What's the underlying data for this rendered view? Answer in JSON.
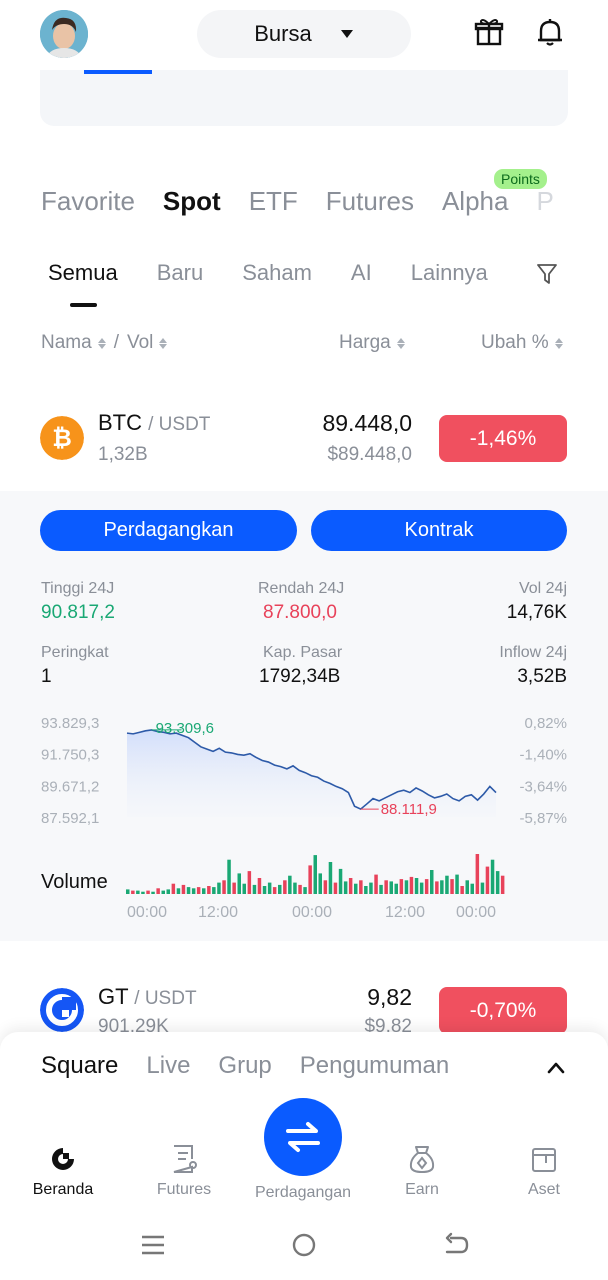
{
  "header": {
    "exchange_label": "Bursa"
  },
  "category_tabs": [
    {
      "label": "Favorite",
      "active": false
    },
    {
      "label": "Spot",
      "active": true
    },
    {
      "label": "ETF",
      "active": false
    },
    {
      "label": "Futures",
      "active": false
    },
    {
      "label": "Alpha",
      "active": false
    },
    {
      "label": "P",
      "active": false
    }
  ],
  "points_badge": "Points",
  "sub_tabs": [
    {
      "label": "Semua",
      "active": true
    },
    {
      "label": "Baru",
      "active": false
    },
    {
      "label": "Saham",
      "active": false
    },
    {
      "label": "AI",
      "active": false
    },
    {
      "label": "Lainnya",
      "active": false
    }
  ],
  "columns": {
    "name": "Nama",
    "separator": "/",
    "vol": "Vol",
    "price": "Harga",
    "change": "Ubah %"
  },
  "btc": {
    "symbol": "BTC",
    "quote": "/ USDT",
    "volume": "1,32B",
    "price": "89.448,0",
    "price_usd": "$89.448,0",
    "change": "-1,46%"
  },
  "detail": {
    "trade_button": "Perdagangkan",
    "contract_button": "Kontrak",
    "high_label": "Tinggi 24J",
    "high_value": "90.817,2",
    "low_label": "Rendah 24J",
    "low_value": "87.800,0",
    "vol_label": "Vol 24j",
    "vol_value": "14,76K",
    "rank_label": "Peringkat",
    "rank_value": "1",
    "mcap_label": "Kap. Pasar",
    "mcap_value": "1792,34B",
    "inflow_label": "Inflow 24j",
    "inflow_value": "3,52B",
    "volume_label": "Volume"
  },
  "chart_data": {
    "type": "line",
    "y_left_ticks": [
      "93.829,3",
      "91.750,3",
      "89.671,2",
      "87.592,1"
    ],
    "y_right_ticks": [
      "0,82%",
      "-1,40%",
      "-3,64%",
      "-5,87%"
    ],
    "x_ticks": [
      "00:00",
      "12:00",
      "00:00",
      "12:00",
      "00:00"
    ],
    "annotations": {
      "high": "93.309,6",
      "low": "88.111,9"
    },
    "ylim": [
      87592.1,
      93829.3
    ],
    "series": [
      {
        "values": [
          93100,
          93050,
          93150,
          93250,
          93309.6,
          93200,
          93150,
          93050,
          93100,
          92950,
          92800,
          92500,
          92200,
          92050,
          91900,
          92100,
          91850,
          91800,
          91700,
          91650,
          91750,
          91500,
          91300,
          91200,
          91000,
          90900,
          90750,
          90950,
          90650,
          90500,
          90300,
          90200,
          89950,
          89800,
          89600,
          89450,
          89200,
          88300,
          88111.9,
          88450,
          88800,
          88650,
          88850,
          89050,
          89250,
          89350,
          89200,
          89500,
          89300,
          89050,
          88850,
          88950,
          89100,
          88800,
          88650,
          88950,
          89050,
          88700,
          89100,
          89600,
          89200
        ]
      }
    ],
    "volume": [
      4,
      3,
      3,
      2,
      3,
      2,
      5,
      3,
      4,
      9,
      5,
      8,
      6,
      5,
      6,
      5,
      7,
      6,
      10,
      12,
      30,
      10,
      18,
      9,
      20,
      8,
      14,
      7,
      10,
      6,
      8,
      12,
      16,
      10,
      8,
      6,
      25,
      34,
      18,
      12,
      28,
      10,
      22,
      11,
      14,
      9,
      12,
      7,
      10,
      17,
      8,
      12,
      11,
      9,
      13,
      12,
      15,
      14,
      10,
      13,
      21,
      11,
      12,
      16,
      13,
      17,
      7,
      12,
      9,
      35,
      10,
      24,
      30,
      20,
      16
    ]
  },
  "gt": {
    "symbol": "GT",
    "quote": "/ USDT",
    "volume": "901,29K",
    "price": "9,82",
    "price_usd": "$9,82",
    "change": "-0,70%"
  },
  "feed_tabs": [
    {
      "label": "Square",
      "active": true
    },
    {
      "label": "Live",
      "active": false
    },
    {
      "label": "Grup",
      "active": false
    },
    {
      "label": "Pengumuman",
      "active": false
    }
  ],
  "bottom_nav": [
    {
      "label": "Beranda",
      "active": true
    },
    {
      "label": "Futures",
      "active": false
    },
    {
      "label": "Perdagangan",
      "active": false
    },
    {
      "label": "Earn",
      "active": false
    },
    {
      "label": "Aset",
      "active": false
    }
  ],
  "colors": {
    "accent": "#0a5bff",
    "up": "#1aa874",
    "down": "#e8425a",
    "badge_red": "#f0505f"
  }
}
